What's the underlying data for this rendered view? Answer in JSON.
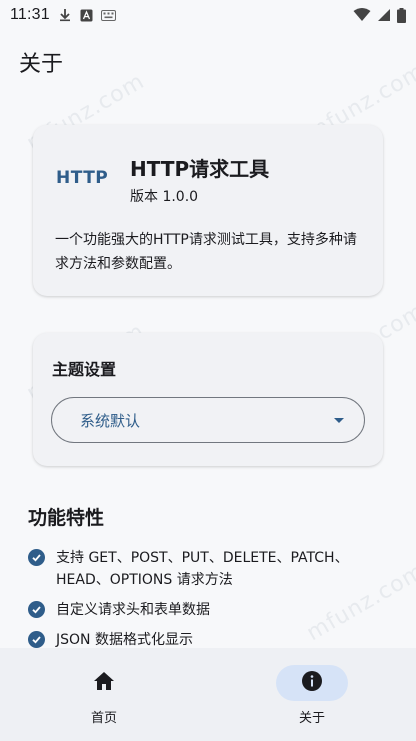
{
  "status_bar": {
    "time": "11:31",
    "icons_left": [
      "download-icon",
      "text-a-icon",
      "keyboard-icon"
    ],
    "icons_right": [
      "wifi-icon",
      "signal-icon",
      "battery-icon"
    ]
  },
  "app_bar": {
    "title": "关于"
  },
  "about_card": {
    "logo_text": "HTTP",
    "app_name": "HTTP请求工具",
    "version": "版本 1.0.0",
    "description": "一个功能强大的HTTP请求测试工具，支持多种请求方法和参数配置。"
  },
  "theme_card": {
    "title": "主题设置",
    "selected_value": "系统默认"
  },
  "features": {
    "title": "功能特性",
    "items": [
      "支持 GET、POST、PUT、DELETE、PATCH、HEAD、OPTIONS 请求方法",
      "自定义请求头和表单数据",
      "JSON 数据格式化显示"
    ]
  },
  "bottom_nav": {
    "items": [
      {
        "label": "首页",
        "icon": "home-icon",
        "active": false
      },
      {
        "label": "关于",
        "icon": "info-icon",
        "active": true
      }
    ]
  },
  "watermark_text": "mfunz.com",
  "colors": {
    "accent": "#2f5d8a",
    "background": "#f7f8fa",
    "card": "#f1f2f5",
    "nav_background": "#eef0f4",
    "nav_active_pill": "#d6e3f7"
  }
}
